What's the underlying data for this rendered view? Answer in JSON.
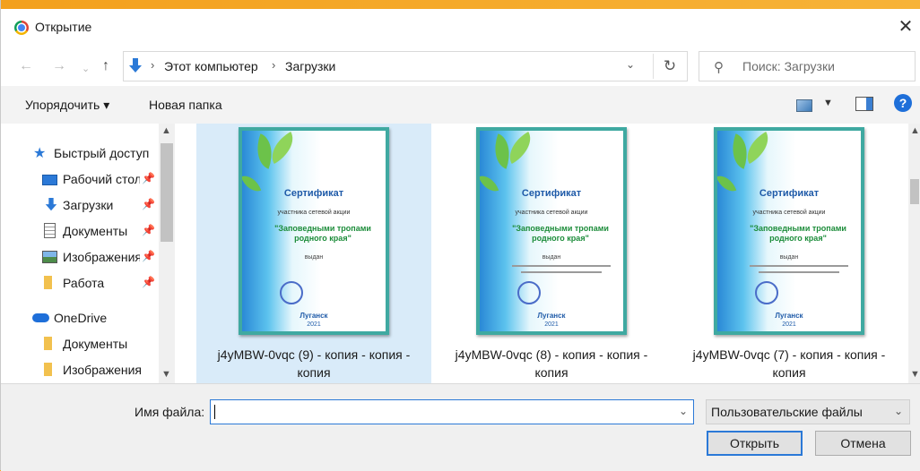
{
  "window": {
    "title": "Открытие"
  },
  "address": {
    "crumbs": [
      "Этот компьютер",
      "Загрузки"
    ],
    "search_placeholder": "Поиск: Загрузки"
  },
  "toolbar": {
    "organize_label": "Упорядочить ▾",
    "new_folder_label": "Новая папка"
  },
  "nav": {
    "quick_access": "Быстрый доступ",
    "items": [
      {
        "label": "Рабочий стол",
        "icon": "desktop-icon",
        "pinned": true
      },
      {
        "label": "Загрузки",
        "icon": "download-icon",
        "pinned": true
      },
      {
        "label": "Документы",
        "icon": "documents-icon",
        "pinned": true
      },
      {
        "label": "Изображения",
        "icon": "images-icon",
        "pinned": true
      },
      {
        "label": "Работа",
        "icon": "folder-icon",
        "pinned": true
      }
    ],
    "onedrive": "OneDrive",
    "onedrive_items": [
      {
        "label": "Документы",
        "icon": "folder-icon"
      },
      {
        "label": "Изображения",
        "icon": "folder-icon"
      }
    ]
  },
  "files": [
    {
      "name": "j4yMBW-0vqc (9) - копия - копия - копия",
      "selected": true,
      "cert": {
        "title": "Сертификат",
        "sub": "участника сетевой акции",
        "quote": "\"Заповедными тропами родного края\"",
        "issued": "выдан",
        "city": "Луганск",
        "year": "2021"
      }
    },
    {
      "name": "j4yMBW-0vqc (8) - копия - копия - копия",
      "selected": false,
      "cert": {
        "title": "Сертификат",
        "sub": "участника сетевой акции",
        "quote": "\"Заповедными тропами родного края\"",
        "issued": "выдан",
        "city": "Луганск",
        "year": "2021"
      }
    },
    {
      "name": "j4yMBW-0vqc (7) - копия - копия - копия",
      "selected": false,
      "cert": {
        "title": "Сертификат",
        "sub": "участника сетевой акции",
        "quote": "\"Заповедными тропами родного края\"",
        "issued": "выдан",
        "city": "Луганск",
        "year": "2021"
      }
    }
  ],
  "bottom": {
    "filename_label": "Имя файла:",
    "filename_value": "",
    "filetype_value": "Пользовательские файлы",
    "open_label": "Открыть",
    "cancel_label": "Отмена"
  },
  "colors": {
    "accent": "#2b79d7",
    "selection": "#d9ebf9",
    "frame": "#f5a623"
  }
}
